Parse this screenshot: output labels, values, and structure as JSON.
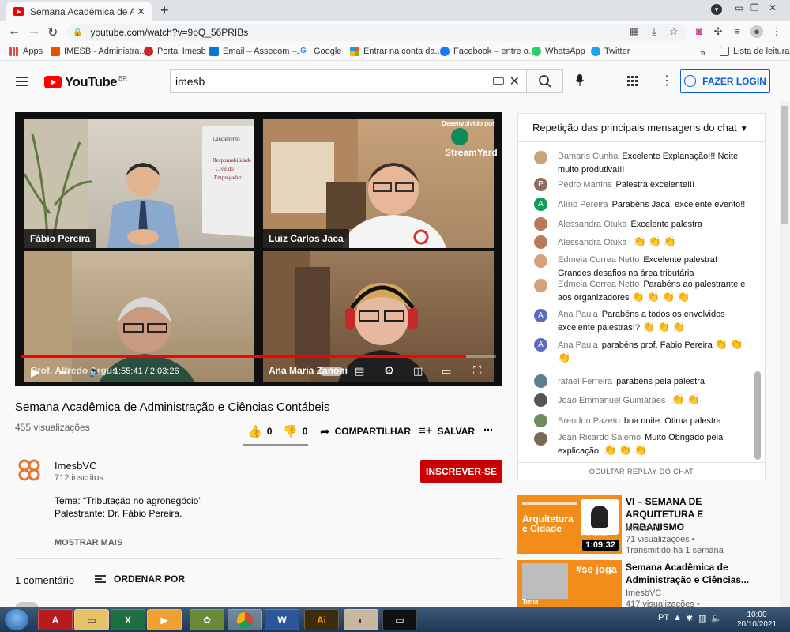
{
  "browser": {
    "tab_title": "Semana Acadêmica de Administ",
    "url": "youtube.com/watch?v=9pQ_56PRIBs",
    "bookmarks": [
      "Apps",
      "IMESB - Administra...",
      "Portal Imesb",
      "Email – Assecom –...",
      "Google",
      "Entrar na conta da...",
      "Facebook – entre o...",
      "WhatsApp",
      "Twitter"
    ],
    "reading_list": "Lista de leitura",
    "overflow": "»"
  },
  "youtube": {
    "logo": "YouTube",
    "country": "BR",
    "search_value": "imesb",
    "login": "FAZER LOGIN"
  },
  "video": {
    "participants": [
      "Fábio Pereira",
      "Luiz Carlos Jaca",
      "Prof. Alfredo Argus",
      "Ana Maria Zanoni"
    ],
    "overlay_developed": "Desenvolvido por",
    "overlay_brand": "StreamYard",
    "time": "1:55:41 / 2:03:26",
    "progress": 0.937,
    "title": "Semana Acadêmica de Administração e Ciências Contábeis",
    "views": "455 visualizações",
    "likes": "0",
    "dislikes": "0",
    "share": "COMPARTILHAR",
    "save": "SALVAR"
  },
  "channel": {
    "name": "ImesbVC",
    "subs": "712 inscritos",
    "subscribe": "INSCREVER-SE",
    "desc_line1": "Tema: “Tributação no agronegócio”",
    "desc_line2": "Palestrante: Dr. Fábio Pereira.",
    "show_more": "MOSTRAR MAIS"
  },
  "comments": {
    "count": "1 comentário",
    "order_by": "ORDENAR POR"
  },
  "chat": {
    "header": "Repetição das principais mensagens do chat",
    "footer": "OCULTAR REPLAY DO CHAT",
    "messages": [
      {
        "author": "Damaris Cunha",
        "text": "Excelente Explanação!!! Noite muito produtiva!!!",
        "emoji": "",
        "avatar": "",
        "color": "#c9a27e"
      },
      {
        "author": "Pedro Martins",
        "text": "Palestra excelente!!!",
        "emoji": "",
        "avatar": "P",
        "color": "#8d6e63"
      },
      {
        "author": "Alírio Pereira",
        "text": "Parabéns Jaca, excelente evento!!",
        "emoji": "",
        "avatar": "A",
        "color": "#0f9d58"
      },
      {
        "author": "Alessandra Otuka",
        "text": "Excelente palestra",
        "emoji": "",
        "avatar": "",
        "color": "#b97a5b"
      },
      {
        "author": "Alessandra Otuka",
        "text": "",
        "emoji": "👏👏👏",
        "avatar": "",
        "color": "#b97a5b"
      },
      {
        "author": "Edmeia Correa Netto",
        "text": "Excelente palestra! Grandes desafios na área tributária",
        "emoji": "",
        "avatar": "",
        "color": "#d6a07a"
      },
      {
        "author": "Edmeia Correa Netto",
        "text": "Parabéns ao palestrante e aos organizadores",
        "emoji": "👏👏👏👏",
        "avatar": "",
        "color": "#d6a07a"
      },
      {
        "author": "Ana Paula",
        "text": "Parabéns a todos os envolvidos excelente palestras!?",
        "emoji": "👏👏👏",
        "avatar": "A",
        "color": "#5c6bc0"
      },
      {
        "author": "Ana Paula",
        "text": "parabéns prof. Fabio Pereira",
        "emoji": "👏👏👏",
        "avatar": "A",
        "color": "#5c6bc0"
      },
      {
        "author": "rafael Ferreira",
        "text": "parabéns pela palestra",
        "emoji": "",
        "avatar": "",
        "color": "#607d8b"
      },
      {
        "author": "João Emmanuel Guimarães",
        "text": "",
        "emoji": "👏👏",
        "avatar": "",
        "color": "#555555"
      },
      {
        "author": "Brendon Pazeto",
        "text": "boa noite. Ótima palestra",
        "emoji": "",
        "avatar": "",
        "color": "#6d8b5b"
      },
      {
        "author": "Jean Ricardo Salemo",
        "text": "Muito Obrigado pela explicação!",
        "emoji": "👏👏👏",
        "avatar": "",
        "color": "#7a6a55"
      }
    ]
  },
  "related": [
    {
      "title": "VI – SEMANA DE ARQUITETURA E URBANISMO",
      "channel": "ImesbVC",
      "meta1": "71 visualizações •",
      "meta2": "Transmitido há 1 semana",
      "duration": "1:09:32",
      "thumb_text": "Arquitetura e Cidade",
      "thumb_sub": "Palestrante",
      "bg": "#f28c1a"
    },
    {
      "title": "Semana Acadêmica de Administração e Ciências...",
      "channel": "ImesbVC",
      "meta1": "417 visualizações •",
      "meta2": "",
      "duration": "",
      "thumb_text": "#se joga",
      "thumb_sub": "Tema",
      "bg": "#f28c1a"
    }
  ],
  "taskbar": {
    "lang": "PT",
    "time": "10:00",
    "date": "20/10/2021"
  }
}
